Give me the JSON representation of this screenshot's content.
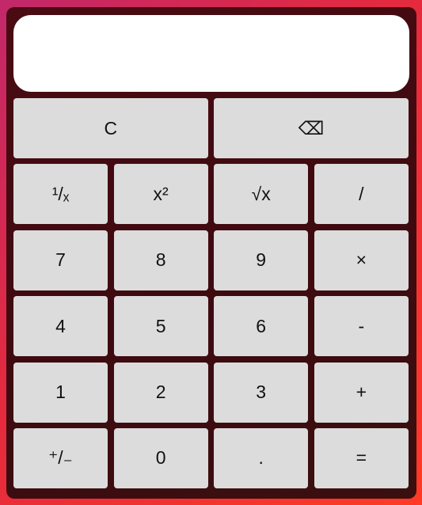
{
  "display": {
    "value": ""
  },
  "keys": {
    "clear": "C",
    "backspace": "⌫",
    "reciprocal": "¹/ₓ",
    "square": "x²",
    "sqrt": "√x",
    "divide": "/",
    "seven": "7",
    "eight": "8",
    "nine": "9",
    "multiply": "×",
    "four": "4",
    "five": "5",
    "six": "6",
    "subtract": "-",
    "one": "1",
    "two": "2",
    "three": "3",
    "add": "+",
    "negate": "⁺/₋",
    "zero": "0",
    "decimal": ".",
    "equals": "="
  },
  "colors": {
    "background_start": "#c2286a",
    "background_end": "#ff3a25",
    "panel": "#420a11",
    "key": "#dcdcdc",
    "display": "#ffffff"
  }
}
